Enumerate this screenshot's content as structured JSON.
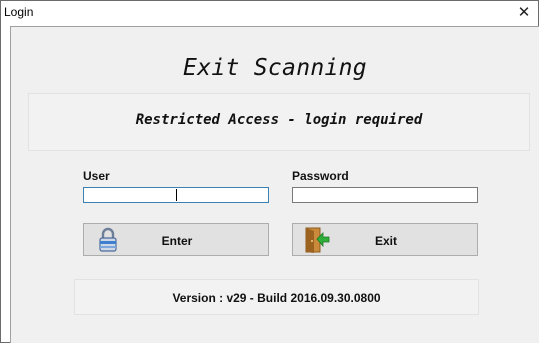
{
  "window": {
    "title": "Login",
    "close_glyph": "✕"
  },
  "form": {
    "heading": "Exit Scanning",
    "banner": "Restricted Access - login required",
    "user_label": "User",
    "user_value": "",
    "password_label": "Password",
    "password_value": ""
  },
  "buttons": {
    "enter_label": "Enter",
    "enter_icon": "lock-icon",
    "exit_label": "Exit",
    "exit_icon": "exit-door-icon"
  },
  "footer": {
    "version": "Version : v29 - Build 2016.09.30.0800"
  },
  "colors": {
    "background": "#f0f0f0",
    "button_face": "#e1e1e1",
    "focus_border": "#3c7fb1"
  }
}
